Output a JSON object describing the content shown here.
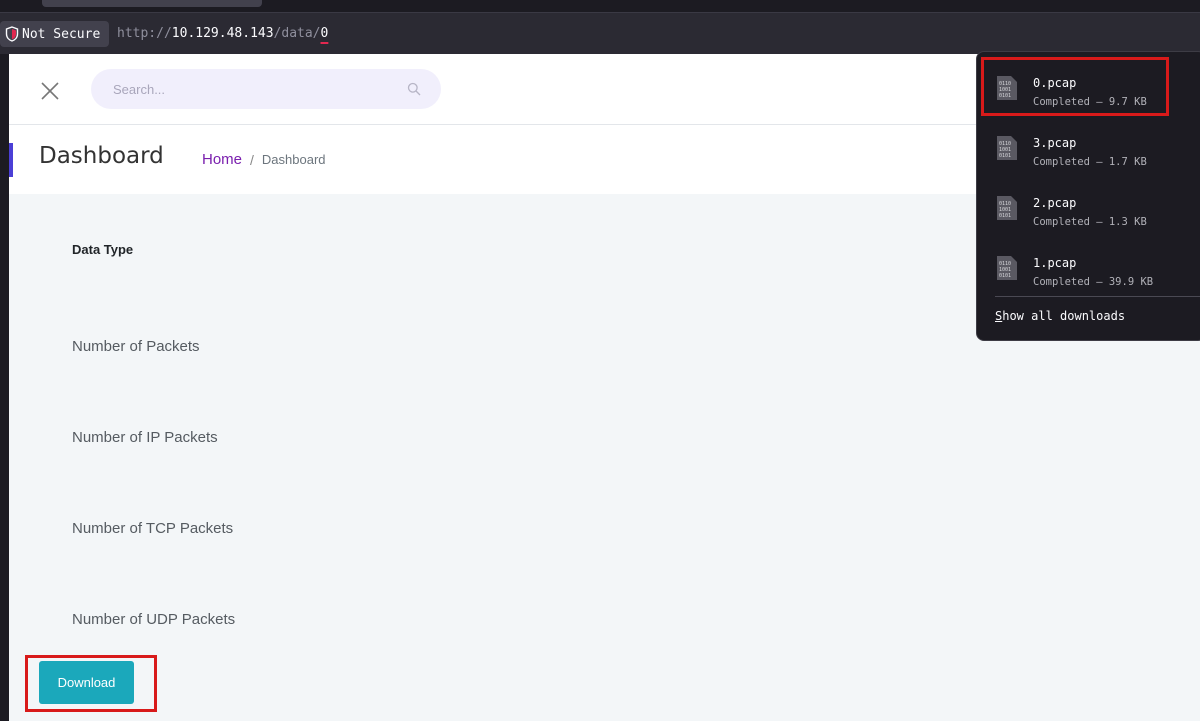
{
  "browser": {
    "security_label": "Not Secure",
    "url_scheme": "http://",
    "url_host": "10.129.48.143",
    "url_path": "/data/",
    "url_last": "0"
  },
  "topbar": {
    "search_placeholder": "Search..."
  },
  "header": {
    "title": "Dashboard",
    "breadcrumb_home": "Home",
    "breadcrumb_sep": "/",
    "breadcrumb_current": "Dashboard"
  },
  "main": {
    "column_header": "Data Type",
    "rows": [
      "Number of Packets",
      "Number of IP Packets",
      "Number of TCP Packets",
      "Number of UDP Packets"
    ],
    "download_label": "Download"
  },
  "downloads": {
    "items": [
      {
        "name": "0.pcap",
        "status": "Completed — 9.7 KB"
      },
      {
        "name": "3.pcap",
        "status": "Completed — 1.7 KB"
      },
      {
        "name": "2.pcap",
        "status": "Completed — 1.3 KB"
      },
      {
        "name": "1.pcap",
        "status": "Completed — 39.9 KB"
      }
    ],
    "show_all_first": "S",
    "show_all_rest": "how all downloads"
  },
  "colors": {
    "highlight": "#d81a1a",
    "accent": "#4b3fd6",
    "button": "#1ba8bb",
    "link": "#7a1fae"
  },
  "icons": [
    "shield-icon",
    "close-icon",
    "search-icon",
    "binary-file-icon"
  ]
}
